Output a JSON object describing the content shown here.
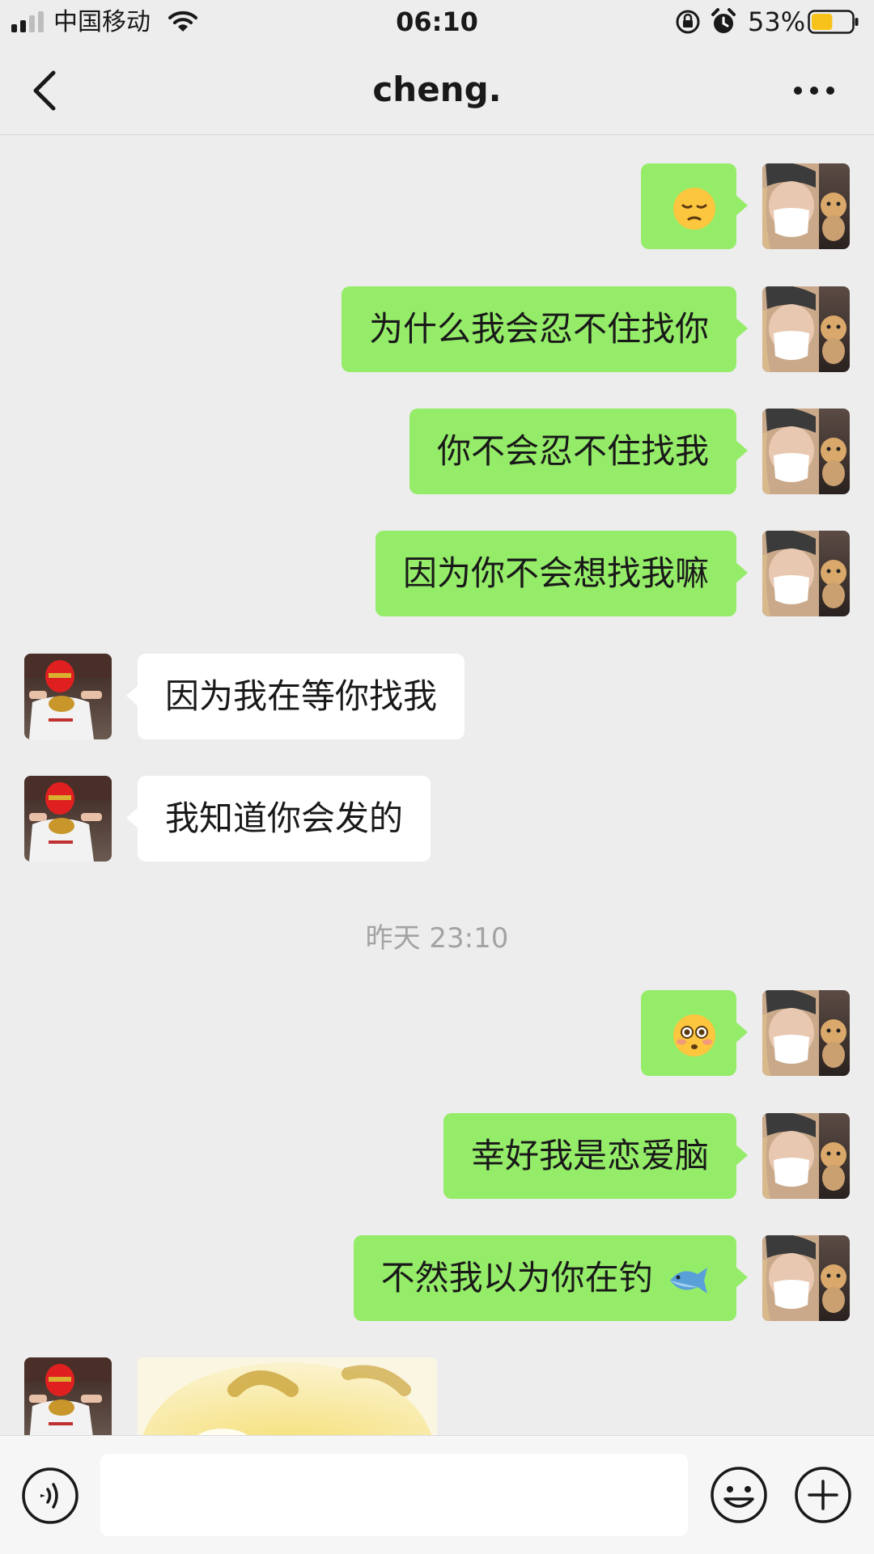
{
  "status_bar": {
    "carrier": "中国移动",
    "time": "06:10",
    "battery_percent": "53%",
    "battery_level": 0.53
  },
  "header": {
    "title": "cheng."
  },
  "messages": [
    {
      "side": "me",
      "text": "",
      "emoji": "pensive-face"
    },
    {
      "side": "me",
      "text": "为什么我会忍不住找你"
    },
    {
      "side": "me",
      "text": "你不会忍不住找我"
    },
    {
      "side": "me",
      "text": "因为你不会想找我嘛"
    },
    {
      "side": "them",
      "text": "因为我在等你找我"
    },
    {
      "side": "them",
      "text": "我知道你会发的"
    },
    {
      "side": "me",
      "text": "",
      "emoji": "flushed-face"
    },
    {
      "side": "me",
      "text": "幸好我是恋爱脑"
    },
    {
      "side": "me",
      "text": "不然我以为你在钓",
      "emoji": "fish"
    },
    {
      "side": "them",
      "text": "",
      "sticker": "yellow-emoji-sticker"
    }
  ],
  "timestamp": "昨天 23:10",
  "input": {
    "placeholder": ""
  },
  "icons": {
    "back": "chevron-left-icon",
    "more": "more-dots-icon",
    "voice": "voice-icon",
    "emoji": "smiley-icon",
    "plus": "plus-icon"
  },
  "colors": {
    "background": "#ededed",
    "my_bubble": "#95ec69",
    "their_bubble": "#ffffff",
    "timestamp": "#a3a3a3"
  }
}
